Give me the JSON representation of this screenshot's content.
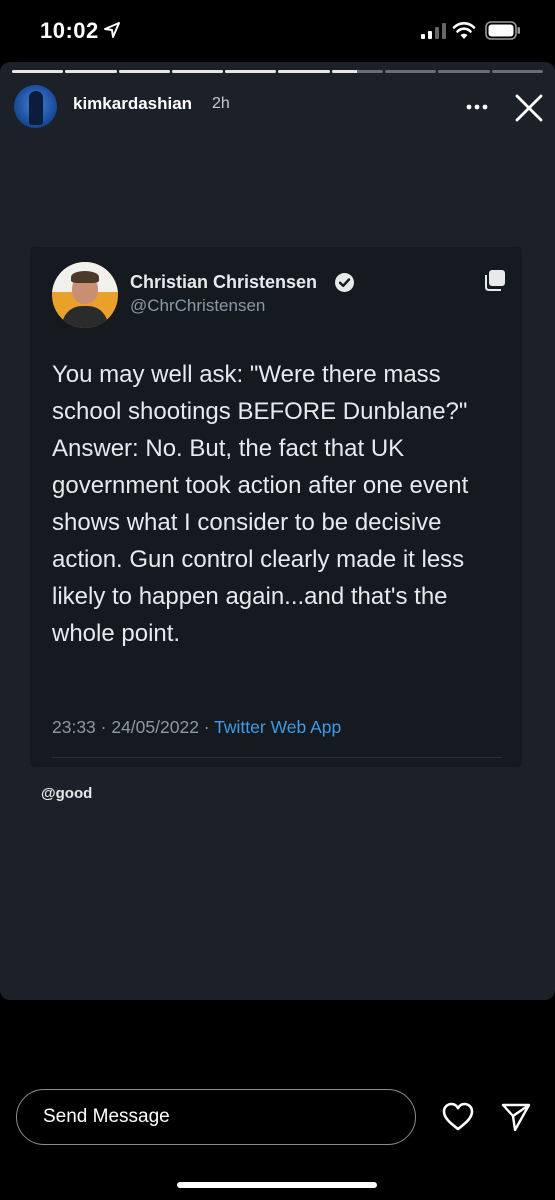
{
  "status_bar": {
    "time": "10:02"
  },
  "story": {
    "username": "kimkardashian",
    "time_ago": "2h",
    "progress": [
      1,
      1,
      1,
      1,
      1,
      1,
      0.5,
      0,
      0,
      0
    ]
  },
  "tweet": {
    "display_name": "Christian Christensen",
    "handle": "@ChrChristensen",
    "text": "You may well ask: \"Were there mass school shootings BEFORE Dunblane?\" Answer: No. But, the fact that UK government took action after one event shows what I consider to be decisive action. Gun control clearly made it less likely to happen again...and that's the whole point.",
    "timestamp": "23:33 · 24/05/2022 · ",
    "source": "Twitter Web App"
  },
  "mention": "@good",
  "composer": {
    "placeholder": "Send Message"
  },
  "colors": {
    "story_background": "#1b2029",
    "tweet_card": "#151a21",
    "link_blue": "#3f9be6"
  }
}
